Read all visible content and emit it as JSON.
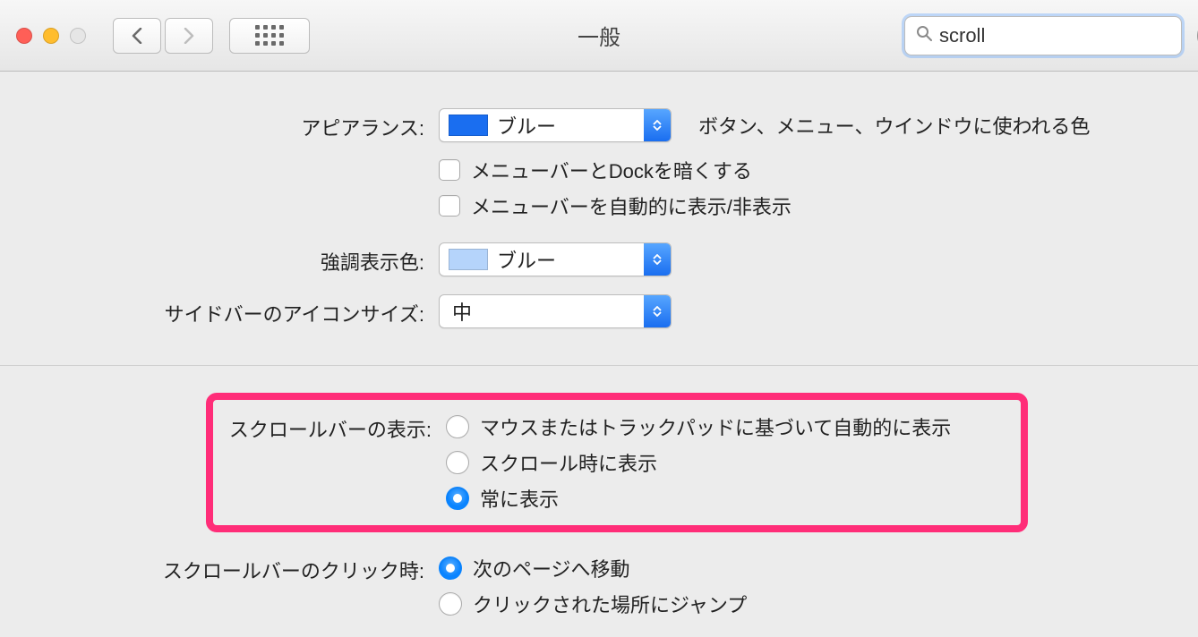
{
  "window": {
    "title": "一般",
    "search_value": "scroll"
  },
  "appearance": {
    "label": "アピアランス:",
    "select_value": "ブルー",
    "hint": "ボタン、メニュー、ウインドウに使われる色"
  },
  "dark_menu": {
    "label": "メニューバーとDockを暗くする",
    "checked": false
  },
  "autohide_menu": {
    "label": "メニューバーを自動的に表示/非表示",
    "checked": false
  },
  "highlight_color": {
    "label": "強調表示色:",
    "select_value": "ブルー"
  },
  "sidebar_icon": {
    "label": "サイドバーのアイコンサイズ:",
    "select_value": "中"
  },
  "show_scrollbars": {
    "label": "スクロールバーの表示:",
    "options": [
      "マウスまたはトラックパッドに基づいて自動的に表示",
      "スクロール時に表示",
      "常に表示"
    ],
    "selected_index": 2
  },
  "click_scrollbar": {
    "label": "スクロールバーのクリック時:",
    "options": [
      "次のページへ移動",
      "クリックされた場所にジャンプ"
    ],
    "selected_index": 0
  }
}
